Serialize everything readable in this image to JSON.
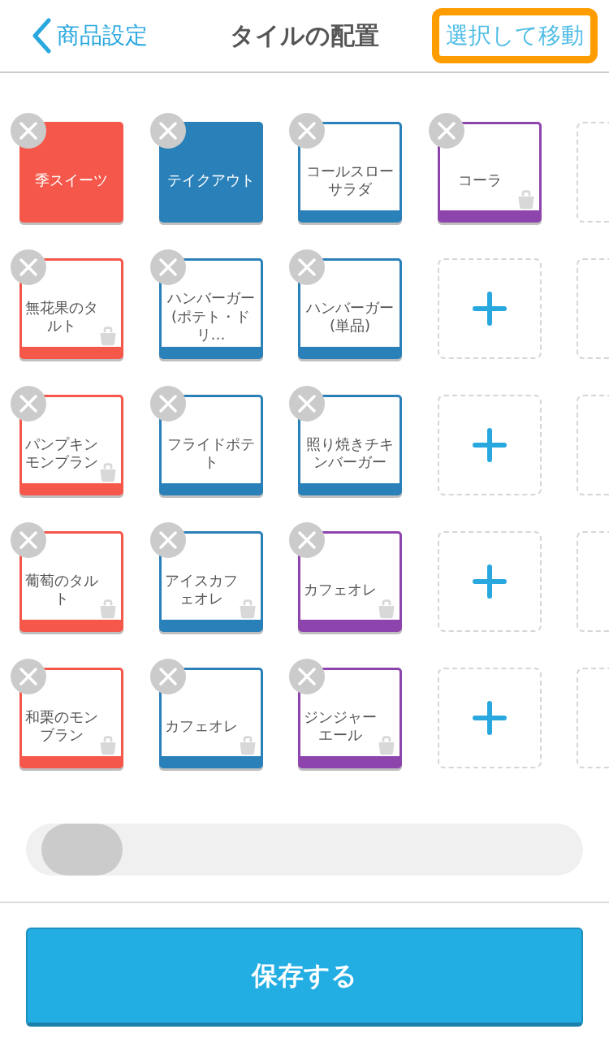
{
  "header": {
    "back": "商品設定",
    "title": "タイルの配置",
    "action": "選択して移動",
    "action_highlighted": true
  },
  "rows": [
    {
      "tiles": [
        {
          "kind": "category",
          "label": "季スイーツ",
          "color": "#f5574a"
        },
        {
          "kind": "category",
          "label": "テイクアウト",
          "color": "#2a80b9"
        },
        {
          "kind": "item",
          "label": "コールスローサラダ",
          "color": "#2a80b9",
          "bag": false
        },
        {
          "kind": "item",
          "label": "コーラ",
          "color": "#8e44ad",
          "bag": true
        },
        {
          "kind": "empty"
        }
      ]
    },
    {
      "tiles": [
        {
          "kind": "item",
          "label": "無花果のタルト",
          "color": "#f5574a",
          "bag": true
        },
        {
          "kind": "item",
          "label": "ハンバーガー(ポテト・ドリ…",
          "color": "#2a80b9",
          "bag": false
        },
        {
          "kind": "item",
          "label": "ハンバーガー(単品)",
          "color": "#2a80b9",
          "bag": false
        },
        {
          "kind": "add"
        },
        {
          "kind": "empty"
        }
      ]
    },
    {
      "tiles": [
        {
          "kind": "item",
          "label": "パンプキンモンブラン",
          "color": "#f5574a",
          "bag": true
        },
        {
          "kind": "item",
          "label": "フライドポテト",
          "color": "#2a80b9",
          "bag": false
        },
        {
          "kind": "item",
          "label": "照り焼きチキンバーガー",
          "color": "#2a80b9",
          "bag": false
        },
        {
          "kind": "add"
        },
        {
          "kind": "empty"
        }
      ]
    },
    {
      "tiles": [
        {
          "kind": "item",
          "label": "葡萄のタルト",
          "color": "#f5574a",
          "bag": true
        },
        {
          "kind": "item",
          "label": "アイスカフェオレ",
          "color": "#2a80b9",
          "bag": true
        },
        {
          "kind": "item",
          "label": "カフェオレ",
          "color": "#8e44ad",
          "bag": true
        },
        {
          "kind": "add"
        },
        {
          "kind": "empty"
        }
      ]
    },
    {
      "tiles": [
        {
          "kind": "item",
          "label": "和栗のモンブラン",
          "color": "#f5574a",
          "bag": true
        },
        {
          "kind": "item",
          "label": "カフェオレ",
          "color": "#2a80b9",
          "bag": true
        },
        {
          "kind": "item",
          "label": "ジンジャーエール",
          "color": "#8e44ad",
          "bag": true
        },
        {
          "kind": "add"
        },
        {
          "kind": "empty"
        }
      ]
    }
  ],
  "save_button": "保存する"
}
